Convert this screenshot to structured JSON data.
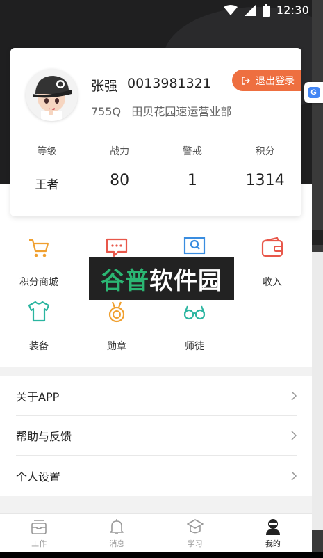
{
  "status_bar": {
    "time": "12:30"
  },
  "profile": {
    "name": "张强",
    "phone": "0013981321",
    "station": "755Q   田贝花园速运营业部",
    "logout_label": "退出登录"
  },
  "stats": [
    {
      "label": "等级",
      "value": "王者"
    },
    {
      "label": "战力",
      "value": "80"
    },
    {
      "label": "警戒",
      "value": "1"
    },
    {
      "label": "积分",
      "value": "1314"
    }
  ],
  "grid": [
    {
      "label": "积分商城",
      "icon": "cart-icon",
      "color": "#f0a030"
    },
    {
      "label": "",
      "icon": "message-icon",
      "color": "#e8574a"
    },
    {
      "label": "",
      "icon": "search-board-icon",
      "color": "#3a8de0"
    },
    {
      "label": "收入",
      "icon": "wallet-icon",
      "color": "#e8574a"
    },
    {
      "label": "装备",
      "icon": "tshirt-icon",
      "color": "#2bb5a0"
    },
    {
      "label": "勋章",
      "icon": "medal-icon",
      "color": "#f0a030"
    },
    {
      "label": "师徒",
      "icon": "glasses-icon",
      "color": "#2bb5a0"
    }
  ],
  "watermark": {
    "text": "谷普软件园"
  },
  "settings": [
    {
      "label": "关于APP"
    },
    {
      "label": "帮助与反馈"
    },
    {
      "label": "个人设置"
    }
  ],
  "tabs": [
    {
      "label": "工作",
      "icon": "inbox-icon",
      "active": false
    },
    {
      "label": "消息",
      "icon": "bell-icon",
      "active": false
    },
    {
      "label": "学习",
      "icon": "graduation-cap-icon",
      "active": false
    },
    {
      "label": "我的",
      "icon": "ninja-user-icon",
      "active": true
    }
  ],
  "colors": {
    "accent": "#ee6f40",
    "header": "#1f1f20"
  }
}
